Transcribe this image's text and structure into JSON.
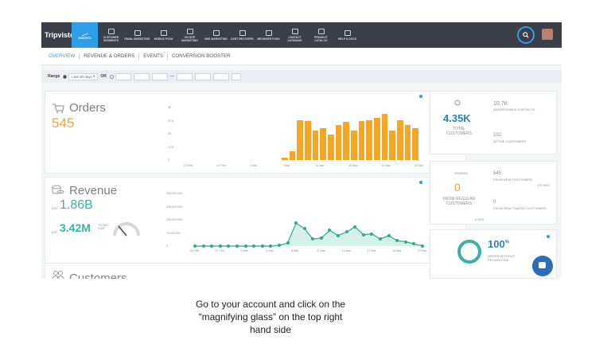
{
  "app": {
    "brand": "Tripvisto"
  },
  "nav": [
    {
      "label": "Insights",
      "icon": "trend-icon",
      "active": true
    },
    {
      "label": "Customer Segments",
      "icon": "clock-icon"
    },
    {
      "label": "Email Marketing",
      "icon": "mail-icon"
    },
    {
      "label": "Mobile Push",
      "icon": "phone-icon"
    },
    {
      "label": "On-Site Marketing",
      "icon": "monitor-icon"
    },
    {
      "label": "Sms Marketing",
      "icon": "chat-icon"
    },
    {
      "label": "Cart Recovery",
      "icon": "cart-icon"
    },
    {
      "label": "Browser Push",
      "icon": "bell-icon"
    },
    {
      "label": "Contact Database",
      "icon": "users-icon"
    },
    {
      "label": "Product Catalog",
      "icon": "catalog-icon"
    },
    {
      "label": "Help & Docs",
      "icon": "bulb-icon"
    }
  ],
  "tabs": [
    {
      "label": "OVERVIEW",
      "active": true
    },
    {
      "label": "REVENUE & ORDERS"
    },
    {
      "label": "EVENTS"
    },
    {
      "label": "CONVERSION BOOSTER"
    }
  ],
  "filter": {
    "range_label": "Range",
    "range_value": "Last 30 days",
    "or_label": "OR",
    "dash": "—"
  },
  "orders": {
    "title": "Orders",
    "value": "545",
    "y_ticks": [
      "50",
      "37.5",
      "25",
      "12.5",
      "0"
    ],
    "x_ticks": [
      "23 Feb",
      "27 Feb",
      "3 Mar",
      "7 Mar",
      "11 Mar",
      "15 Mar",
      "19 Mar",
      "23 Mar"
    ]
  },
  "revenue": {
    "title": "Revenue",
    "currency": "IDR",
    "value": "1.86B",
    "ticket_currency": "IDR",
    "ticket_value": "3.42M",
    "ticket_label": "TICKET SIZE",
    "y_ticks": [
      "300,000,000",
      "225,000,000",
      "150,000,000",
      "75,000,000",
      "0"
    ],
    "x_ticks": [
      "24 Feb",
      "27 Feb",
      "2 Mar",
      "5 Mar",
      "8 Mar",
      "11 Mar",
      "14 Mar",
      "17 Mar",
      "20 Mar",
      "23 Mar"
    ]
  },
  "customers": {
    "title": "Customers"
  },
  "summary": {
    "total_value": "4.35K",
    "total_label": "TOTAL CUSTOMERS",
    "addressable_value": "10.7K",
    "addressable_label": "ADDRESSABLE CONTACTS",
    "active_value": "232",
    "active_label": "ACTIVE CUSTOMERS"
  },
  "orders_summary": {
    "title": "ORDERS",
    "regular_value": "0",
    "regular_label": "FROM REGULAR CUSTOMERS",
    "new_value": "545",
    "new_label": "FROM NEW CUSTOMERS",
    "new_pct": "100.00%",
    "reactivated_value": "0",
    "reactivated_label": "FROM REACTIVATED CUSTOMERS",
    "regular_pct": "0.00%"
  },
  "promo": {
    "value": "100",
    "unit": "%",
    "label": "ORDER WITHOUT PROMOCODE"
  },
  "caption": {
    "line1": "Go to your account and click on the",
    "line2": "“magnifying glass” on the top right",
    "line3": "hand side"
  },
  "chart_data": [
    {
      "type": "bar",
      "title": "Orders",
      "categories": [
        "23 Feb",
        "24 Feb",
        "25 Feb",
        "26 Feb",
        "27 Feb",
        "28 Feb",
        "1 Mar",
        "2 Mar",
        "3 Mar",
        "4 Mar",
        "5 Mar",
        "6 Mar",
        "7 Mar",
        "8 Mar",
        "9 Mar",
        "10 Mar",
        "11 Mar",
        "12 Mar",
        "13 Mar",
        "14 Mar",
        "15 Mar",
        "16 Mar",
        "17 Mar",
        "18 Mar",
        "19 Mar",
        "20 Mar",
        "21 Mar",
        "22 Mar",
        "23 Mar",
        "24 Mar"
      ],
      "values": [
        0,
        0,
        0,
        0,
        0,
        0,
        0,
        0,
        0,
        0,
        0,
        0,
        2,
        8,
        38,
        37,
        28,
        30,
        24,
        33,
        36,
        28,
        37,
        38,
        40,
        44,
        28,
        38,
        33,
        30
      ],
      "ylim": [
        0,
        50
      ],
      "color": "#f5a623"
    },
    {
      "type": "area",
      "title": "Revenue",
      "categories": [
        "24 Feb",
        "25 Feb",
        "26 Feb",
        "27 Feb",
        "28 Feb",
        "1 Mar",
        "2 Mar",
        "3 Mar",
        "4 Mar",
        "5 Mar",
        "6 Mar",
        "7 Mar",
        "8 Mar",
        "9 Mar",
        "10 Mar",
        "11 Mar",
        "12 Mar",
        "13 Mar",
        "14 Mar",
        "15 Mar",
        "16 Mar",
        "17 Mar",
        "18 Mar",
        "19 Mar",
        "20 Mar",
        "21 Mar",
        "22 Mar",
        "23 Mar"
      ],
      "values": [
        0,
        0,
        0,
        0,
        0,
        0,
        0,
        0,
        0,
        0,
        3000000,
        18000000,
        130000000,
        100000000,
        40000000,
        45000000,
        90000000,
        60000000,
        80000000,
        110000000,
        65000000,
        70000000,
        40000000,
        60000000,
        30000000,
        25000000,
        12000000,
        2000000
      ],
      "ylim": [
        0,
        300000000
      ],
      "color": "#2fa98f"
    }
  ]
}
